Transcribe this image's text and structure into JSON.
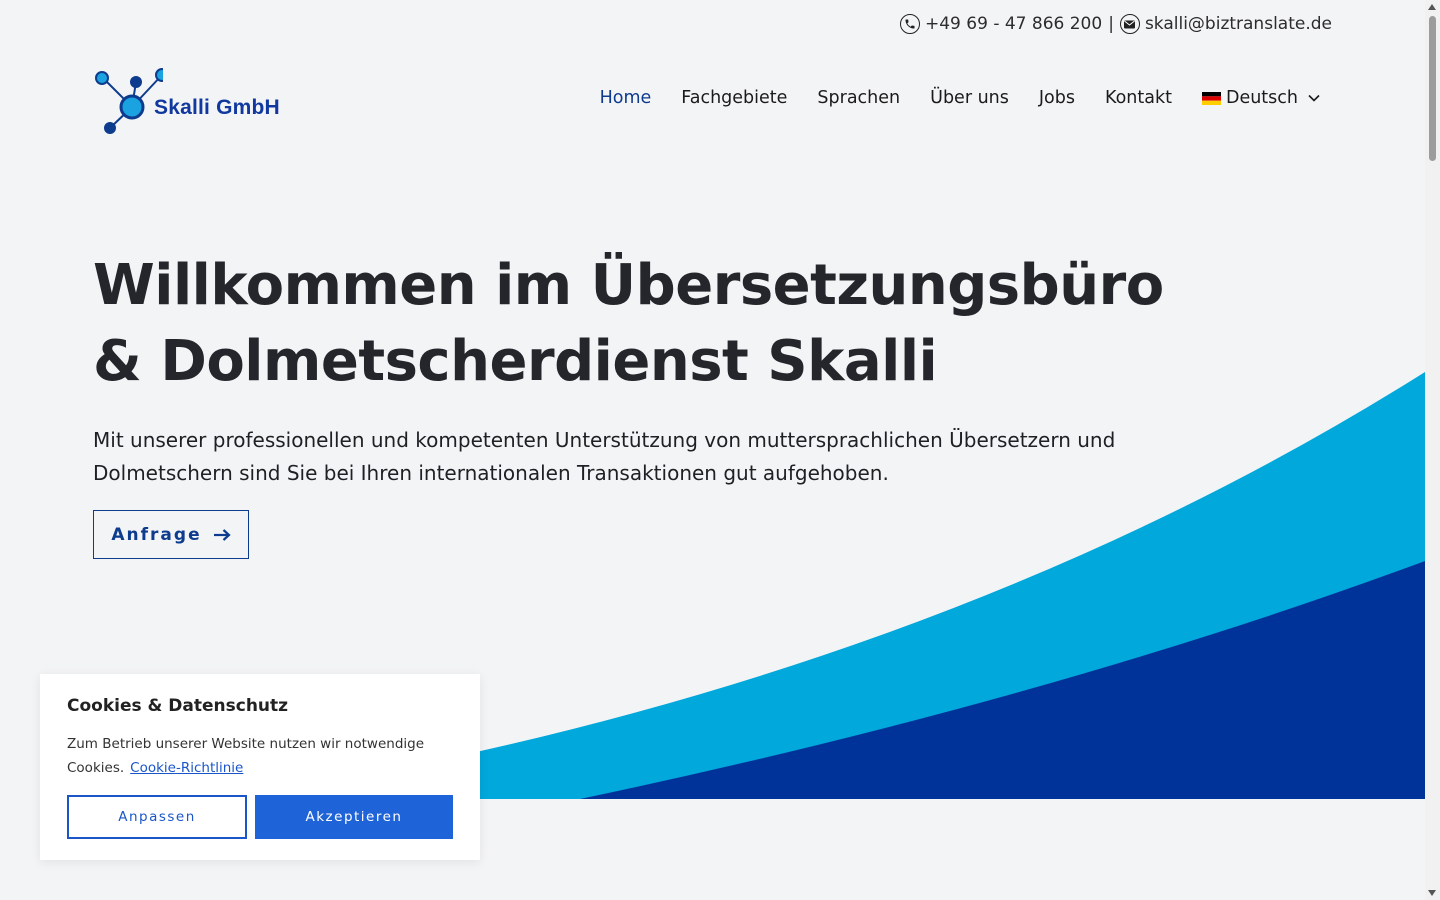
{
  "topbar": {
    "phone": "+49 69 - 47 866 200",
    "separator": "|",
    "email": "skalli@biztranslate.de",
    "phone_icon": "phone-icon",
    "email_icon": "envelope-icon"
  },
  "logo": {
    "text": "Skalli GmbH"
  },
  "nav": {
    "items": [
      {
        "label": "Home",
        "active": true
      },
      {
        "label": "Fachgebiete"
      },
      {
        "label": "Sprachen"
      },
      {
        "label": "Über uns"
      },
      {
        "label": "Jobs"
      },
      {
        "label": "Kontakt"
      }
    ],
    "language": "Deutsch"
  },
  "hero": {
    "title": "Willkommen im Übersetzungsbüro & Dolmetscherdienst Skalli",
    "subtitle": "Mit unserer professionellen und kompetenten Unterstützung von muttersprachlichen Übersetzern und Dolmetschern sind Sie bei Ihren internationalen Transaktionen gut aufgehoben.",
    "button": "Anfrage"
  },
  "cookie": {
    "title": "Cookies & Datenschutz",
    "text": "Zum Betrieb unserer Website nutzen wir notwendige Cookies.",
    "link": "Cookie-Richtlinie",
    "customize": "Anpassen",
    "accept": "Akzeptieren"
  },
  "colors": {
    "brand_dark": "#0d3b8d",
    "wave_light": "#00a8dc",
    "wave_dark": "#003399",
    "accept_button": "#1f63d8",
    "background": "#f3f4f6"
  }
}
